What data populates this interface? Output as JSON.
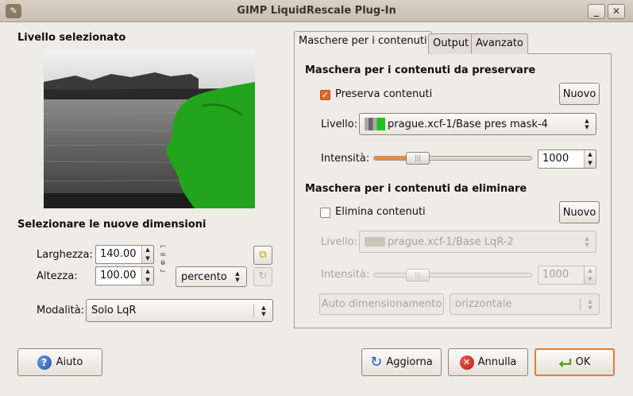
{
  "window": {
    "title": "GIMP LiquidRescale Plug-In"
  },
  "left": {
    "selected_layer_heading": "Livello selezionato",
    "new_size_heading": "Selezionare le nuove dimensioni",
    "width_label": "Larghezza:",
    "width_value": "140.00",
    "height_label": "Altezza:",
    "height_value": "100.00",
    "unit_value": "percento",
    "mode_label": "Modalità:",
    "mode_value": "Solo LqR"
  },
  "tabs": [
    {
      "label": "Maschere per i contenuti",
      "active": true
    },
    {
      "label": "Output",
      "active": false
    },
    {
      "label": "Avanzato",
      "active": false
    }
  ],
  "preserve": {
    "heading": "Maschera per i contenuti da preservare",
    "checkbox_label": "Preserva contenuti",
    "checked": true,
    "new_button": "Nuovo",
    "layer_label": "Livello:",
    "layer_value": "prague.xcf-1/Base pres mask-4",
    "intensity_label": "Intensità:",
    "intensity_value": "1000",
    "slider_fraction": 0.28
  },
  "discard": {
    "heading": "Maschera per i contenuti da eliminare",
    "checkbox_label": "Elimina contenuti",
    "checked": false,
    "new_button": "Nuovo",
    "layer_label": "Livello:",
    "layer_value": "prague.xcf-1/Base LqR-2",
    "intensity_label": "Intensità:",
    "intensity_value": "1000",
    "slider_fraction": 0.28,
    "auto_button": "Auto dimensionamento",
    "orientation_value": "orizzontale"
  },
  "footer": {
    "help_button": "Aiuto",
    "refresh_button": "Aggiorna",
    "cancel_button": "Annulla",
    "ok_button": "OK"
  },
  "colors": {
    "accent": "#e0662a",
    "mask_green": "#22a51c",
    "ok_border": "#e57d35"
  },
  "icons": {
    "wm": "gimp-icon",
    "help": "help-icon",
    "refresh": "refresh-icon",
    "cancel": "cancel-icon",
    "ok": "ok-arrow-icon"
  }
}
